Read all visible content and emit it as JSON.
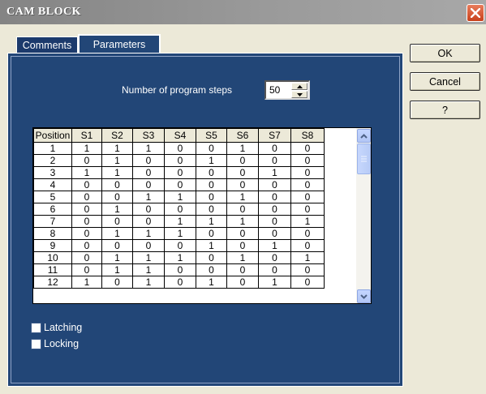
{
  "window": {
    "title": "CAM BLOCK"
  },
  "tabs": [
    {
      "label": "Comments",
      "active": false
    },
    {
      "label": "Parameters",
      "active": true
    }
  ],
  "parameters": {
    "steps_label": "Number of program steps",
    "steps_value": "50"
  },
  "grid": {
    "columns": [
      "Position",
      "S1",
      "S2",
      "S3",
      "S4",
      "S5",
      "S6",
      "S7",
      "S8"
    ],
    "rows": [
      [
        "1",
        "1",
        "1",
        "1",
        "0",
        "0",
        "1",
        "0",
        "0"
      ],
      [
        "2",
        "0",
        "1",
        "0",
        "0",
        "1",
        "0",
        "0",
        "0"
      ],
      [
        "3",
        "1",
        "1",
        "0",
        "0",
        "0",
        "0",
        "1",
        "0"
      ],
      [
        "4",
        "0",
        "0",
        "0",
        "0",
        "0",
        "0",
        "0",
        "0"
      ],
      [
        "5",
        "0",
        "0",
        "1",
        "1",
        "0",
        "1",
        "0",
        "0"
      ],
      [
        "6",
        "0",
        "1",
        "0",
        "0",
        "0",
        "0",
        "0",
        "0"
      ],
      [
        "7",
        "0",
        "0",
        "0",
        "1",
        "1",
        "1",
        "0",
        "1"
      ],
      [
        "8",
        "0",
        "1",
        "1",
        "1",
        "0",
        "0",
        "0",
        "0"
      ],
      [
        "9",
        "0",
        "0",
        "0",
        "0",
        "1",
        "0",
        "1",
        "0"
      ],
      [
        "10",
        "0",
        "1",
        "1",
        "1",
        "0",
        "1",
        "0",
        "1"
      ],
      [
        "11",
        "0",
        "1",
        "1",
        "0",
        "0",
        "0",
        "0",
        "0"
      ],
      [
        "12",
        "1",
        "0",
        "1",
        "0",
        "1",
        "0",
        "1",
        "0"
      ]
    ]
  },
  "options": {
    "latching_label": "Latching",
    "locking_label": "Locking"
  },
  "buttons": {
    "ok": "OK",
    "cancel": "Cancel",
    "help": "?"
  },
  "colors": {
    "panel": "#224677",
    "dialog": "#ECE9D8",
    "close": "#C8401C"
  }
}
